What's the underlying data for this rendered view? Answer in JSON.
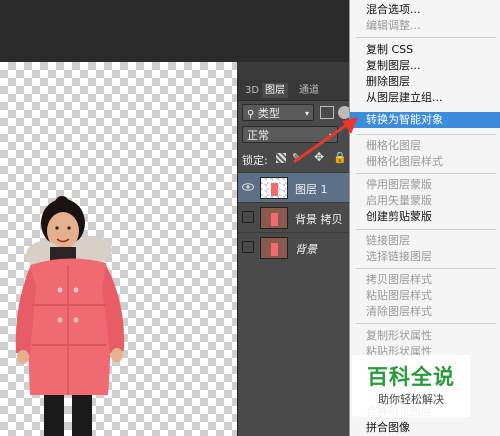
{
  "layers_panel": {
    "tabs": [
      "3D",
      "图层",
      "通道"
    ],
    "active_tab": "图层",
    "filter_kind": "类型",
    "blend_mode": "正常",
    "lock_label": "锁定:",
    "layers": [
      {
        "name": "图层 1",
        "selected": true
      },
      {
        "name": "背景 拷贝",
        "selected": false
      },
      {
        "name": "背景",
        "selected": false
      }
    ]
  },
  "context_menu": {
    "items": [
      {
        "label": "混合选项...",
        "enabled": true,
        "highlighted": false
      },
      {
        "label": "编辑调整...",
        "enabled": false,
        "highlighted": false
      },
      {
        "label": "复制 CSS",
        "enabled": true,
        "highlighted": false
      },
      {
        "label": "复制图层...",
        "enabled": true,
        "highlighted": false
      },
      {
        "label": "删除图层",
        "enabled": true,
        "highlighted": false
      },
      {
        "label": "从图层建立组...",
        "enabled": true,
        "highlighted": false
      },
      {
        "label": "转换为智能对象",
        "enabled": true,
        "highlighted": true
      },
      {
        "label": "栅格化图层",
        "enabled": false,
        "highlighted": false
      },
      {
        "label": "栅格化图层样式",
        "enabled": false,
        "highlighted": false
      },
      {
        "label": "停用图层蒙版",
        "enabled": false,
        "highlighted": false
      },
      {
        "label": "启用矢量蒙版",
        "enabled": false,
        "highlighted": false
      },
      {
        "label": "创建剪贴蒙版",
        "enabled": true,
        "highlighted": false
      },
      {
        "label": "链接图层",
        "enabled": false,
        "highlighted": false
      },
      {
        "label": "选择链接图层",
        "enabled": false,
        "highlighted": false
      },
      {
        "label": "拷贝图层样式",
        "enabled": false,
        "highlighted": false
      },
      {
        "label": "粘贴图层样式",
        "enabled": false,
        "highlighted": false
      },
      {
        "label": "清除图层样式",
        "enabled": false,
        "highlighted": false
      },
      {
        "label": "复制形状属性",
        "enabled": false,
        "highlighted": false
      },
      {
        "label": "粘贴形状属性",
        "enabled": false,
        "highlighted": false
      },
      {
        "label": "合并可见图层",
        "enabled": false,
        "highlighted": false
      },
      {
        "label": "拼合图像",
        "enabled": true,
        "highlighted": false
      }
    ]
  },
  "watermark": {
    "title": "百科全说",
    "subtitle": "助你轻松解决"
  },
  "colors": {
    "highlight": "#3c8cdc",
    "arrow": "#e8372c",
    "selected_layer": "#5d7087"
  }
}
